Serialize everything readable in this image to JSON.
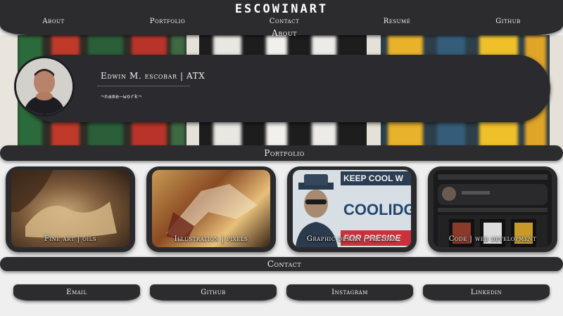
{
  "header": {
    "logo": "ESCOWINART",
    "nav": [
      "About",
      "Portfolio",
      "Contact",
      "Resumé",
      "Github"
    ]
  },
  "about": {
    "label": "About",
    "name": "Edwin M. escobar | ATX",
    "tagline": "¬name—work¬"
  },
  "portfolio": {
    "label": "Portfolio",
    "cards": [
      {
        "label": "Fine art | oils"
      },
      {
        "label": "Illustration | pixels"
      },
      {
        "label": "Graphic design | vectors",
        "poster_line1": "KEEP COOL W",
        "poster_line2": "COOLIDG",
        "poster_line3": "FOR PRESIDE"
      },
      {
        "label": "Code | web development"
      }
    ]
  },
  "contact": {
    "label": "Contact",
    "buttons": [
      "Email",
      "Github",
      "Instagram",
      "Linkedin"
    ]
  },
  "colors": {
    "bar": "#2c2c2f",
    "background": "#efefef"
  }
}
